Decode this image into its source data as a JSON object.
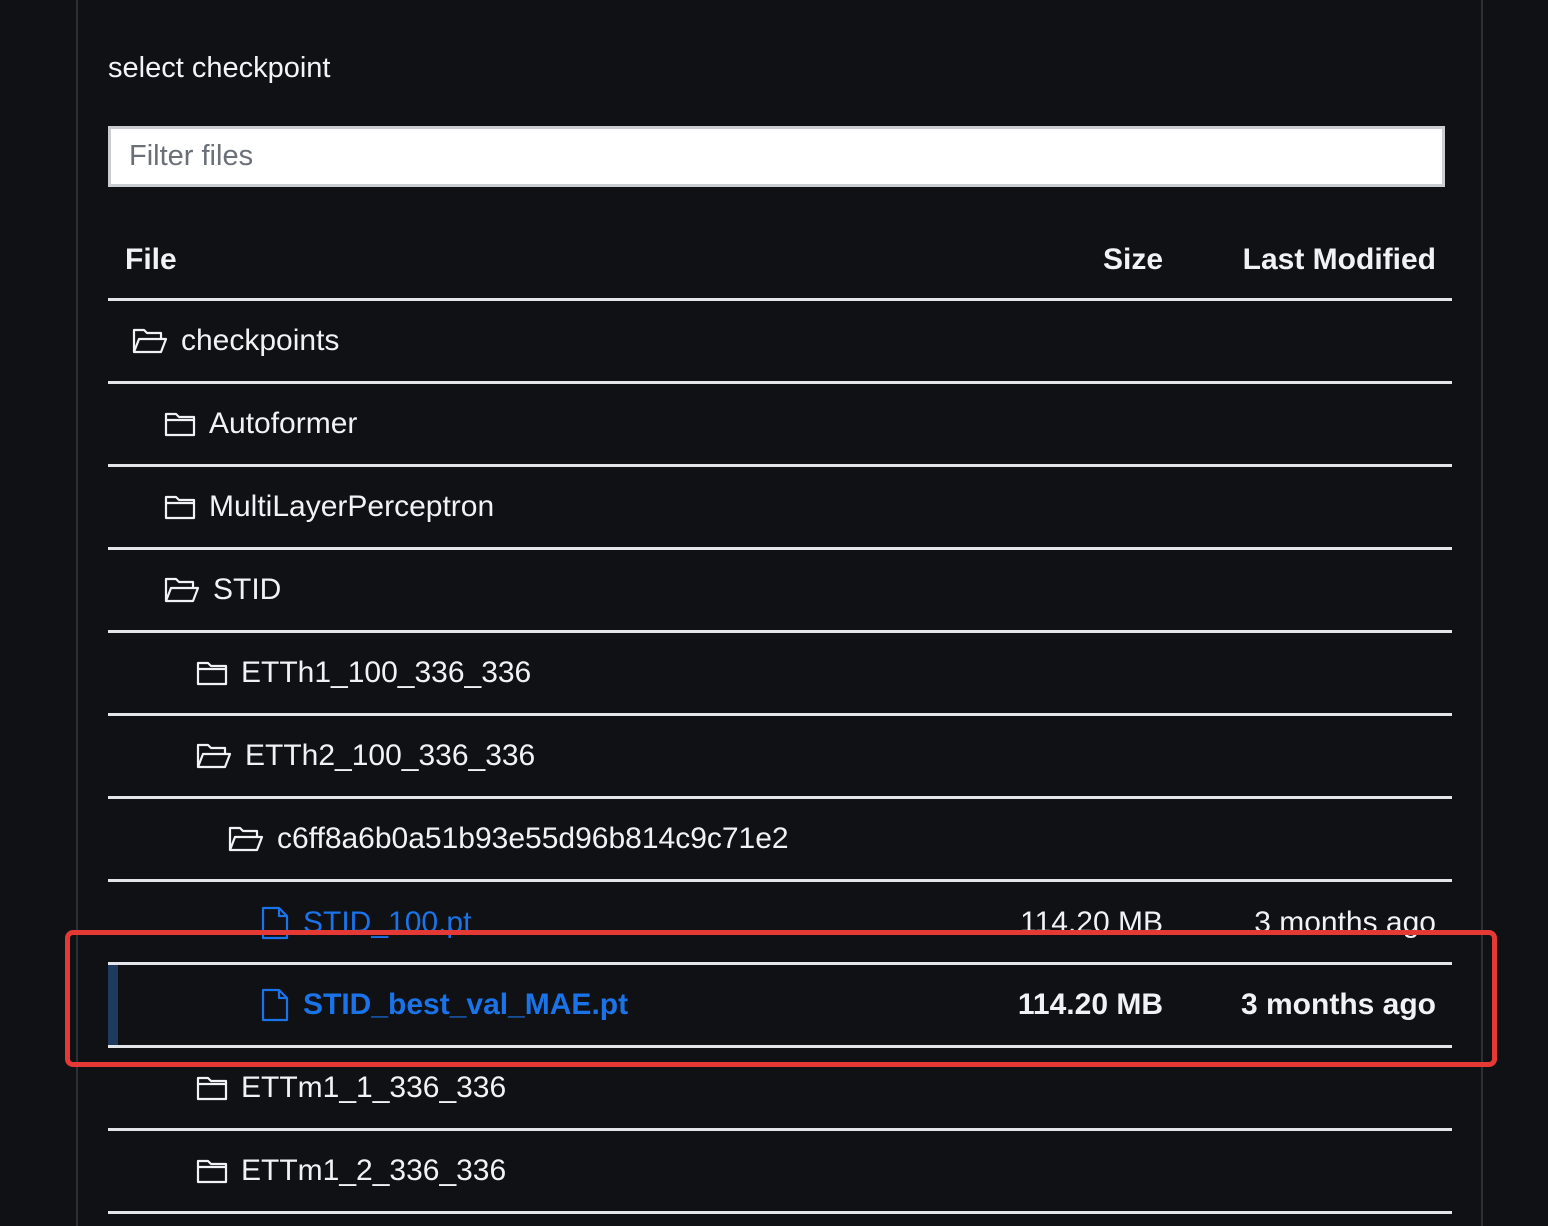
{
  "title": "select checkpoint",
  "filter": {
    "placeholder": "Filter files",
    "value": ""
  },
  "columns": {
    "file": "File",
    "size": "Size",
    "modified": "Last Modified"
  },
  "rows": [
    {
      "name": "checkpoints",
      "type": "folder-open",
      "size": "",
      "modified": ""
    },
    {
      "name": "Autoformer",
      "type": "folder",
      "size": "",
      "modified": ""
    },
    {
      "name": "MultiLayerPerceptron",
      "type": "folder",
      "size": "",
      "modified": ""
    },
    {
      "name": "STID",
      "type": "folder-open",
      "size": "",
      "modified": ""
    },
    {
      "name": "ETTh1_100_336_336",
      "type": "folder",
      "size": "",
      "modified": ""
    },
    {
      "name": "ETTh2_100_336_336",
      "type": "folder-open",
      "size": "",
      "modified": ""
    },
    {
      "name": "c6ff8a6b0a51b93e55d96b814c9c71e2",
      "type": "folder-open",
      "size": "",
      "modified": ""
    },
    {
      "name": "STID_100.pt",
      "type": "file",
      "size": "114.20 MB",
      "modified": "3 months ago"
    },
    {
      "name": "STID_best_val_MAE.pt",
      "type": "file",
      "size": "114.20 MB",
      "modified": "3 months ago",
      "selected": true
    },
    {
      "name": "ETTm1_1_336_336",
      "type": "folder",
      "size": "",
      "modified": ""
    },
    {
      "name": "ETTm1_2_336_336",
      "type": "folder",
      "size": "",
      "modified": ""
    }
  ],
  "colors": {
    "link": "#1a73e8",
    "highlight": "#e53935",
    "background": "#0f1115"
  }
}
